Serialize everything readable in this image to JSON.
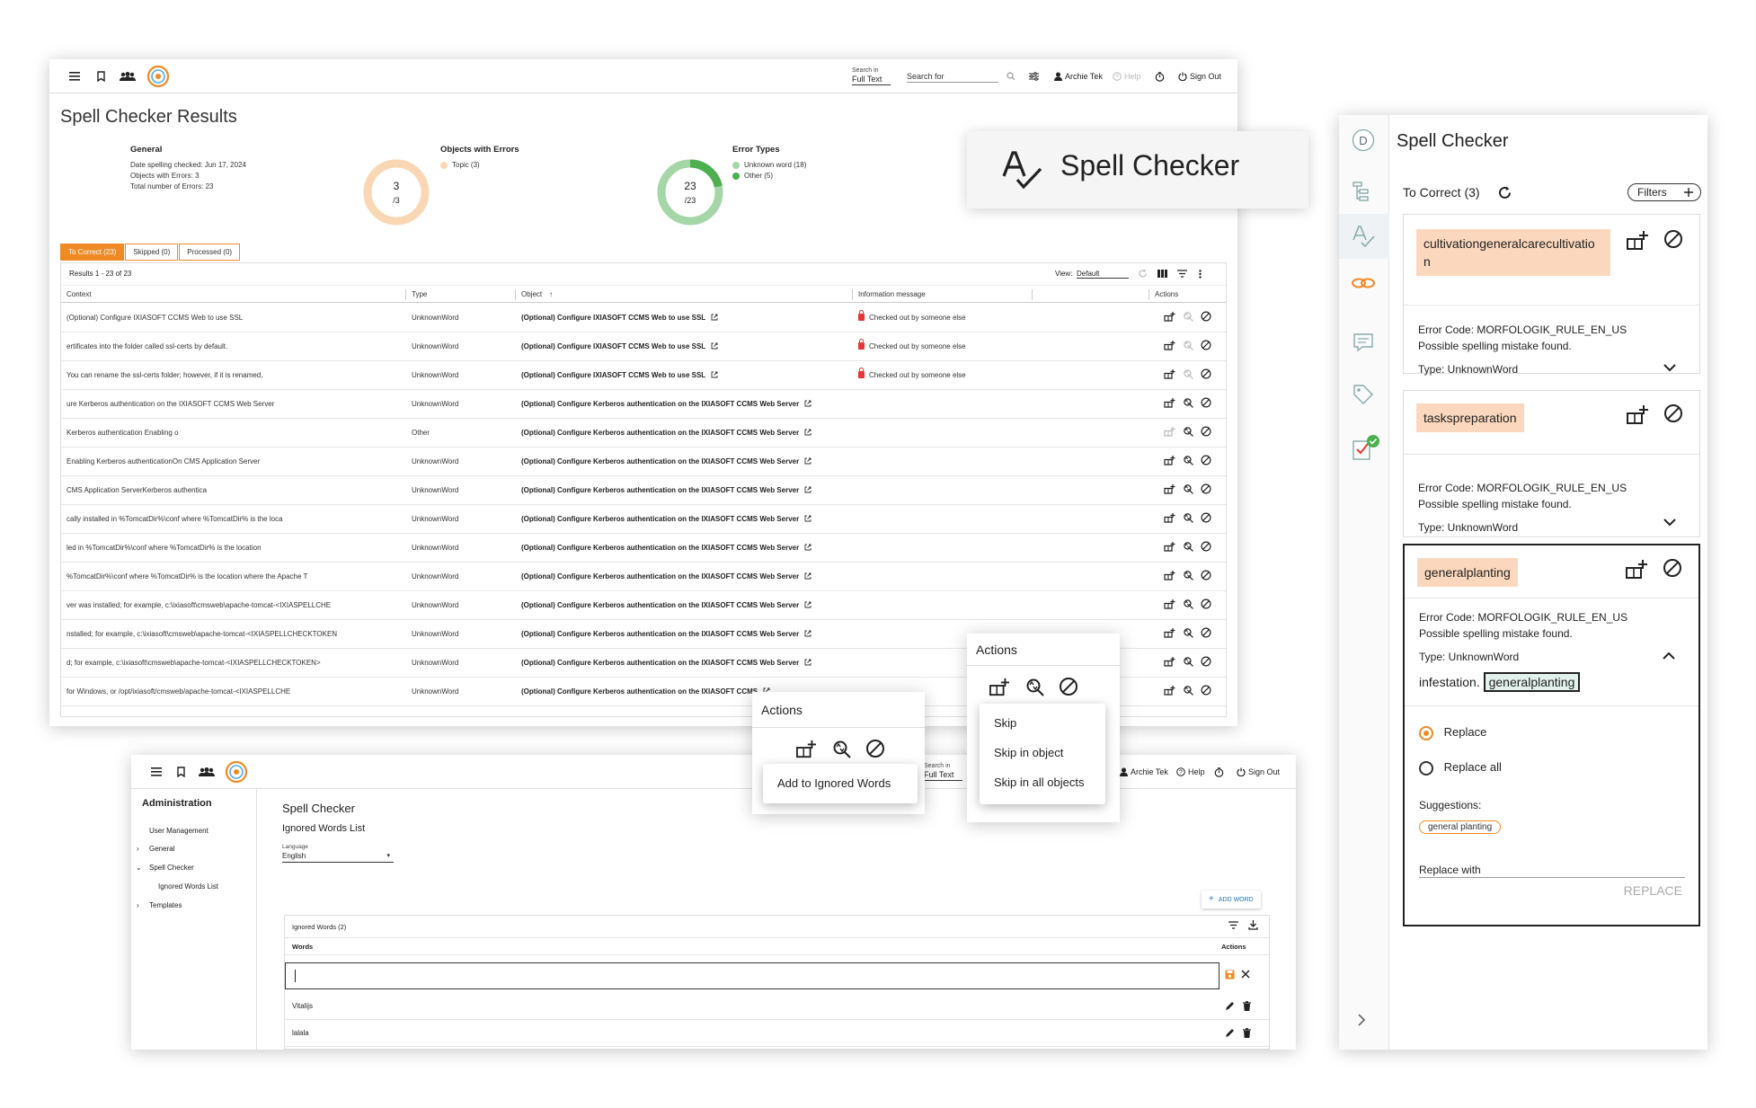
{
  "main": {
    "header": {
      "search_in_label": "Search in",
      "search_in_value": "Full Text",
      "search_placeholder": "Search for",
      "user": "Archie Tek",
      "help": "Help",
      "sign_out": "Sign Out"
    },
    "title": "Spell Checker Results",
    "general": {
      "heading": "General",
      "date": "Date spelling checked: Jun 17, 2024",
      "objects": "Objects with Errors: 3",
      "total": "Total number of Errors: 23"
    },
    "objects_with_errors": {
      "heading": "Objects with Errors",
      "legend": "Topic (3)",
      "value": "3",
      "total": "/3",
      "fraction": 1.0,
      "color": "#f9d7b4"
    },
    "error_types": {
      "heading": "Error Types",
      "legend": [
        "Unknown word (18)",
        "Other (5)"
      ],
      "colors": [
        "#a5d6a7",
        "#4caf50"
      ],
      "value": "23",
      "total": "/23",
      "unknown": 18,
      "other": 5
    },
    "tabs": [
      "To Correct (23)",
      "Skipped (0)",
      "Processed (0)"
    ],
    "results_count": "Results 1 - 23 of 23",
    "view_label": "View:",
    "view_value": "Default",
    "columns": [
      "Context",
      "Type",
      "Object",
      "Information message",
      "Actions"
    ],
    "rows": [
      {
        "context": "(Optional) Configure IXIASOFT CCMS Web to use SSL",
        "type": "UnknownWord",
        "object": "(Optional) Configure IXIASOFT CCMS Web to use SSL",
        "info": "Checked out by someone else"
      },
      {
        "context": "ertificates into the folder called ssl-certs by default.",
        "type": "UnknownWord",
        "object": "(Optional) Configure IXIASOFT CCMS Web to use SSL",
        "info": "Checked out by someone else"
      },
      {
        "context": "You can rename the ssl-certs folder; however, if it is renamed,",
        "type": "UnknownWord",
        "object": "(Optional) Configure IXIASOFT CCMS Web to use SSL",
        "info": "Checked out by someone else"
      },
      {
        "context": "ure Kerberos authentication on the IXIASOFT CCMS Web Server",
        "type": "UnknownWord",
        "object": "(Optional) Configure Kerberos authentication on the IXIASOFT CCMS Web Server",
        "info": ""
      },
      {
        "context": "Kerberos authentication Enabling o",
        "type": "Other",
        "object": "(Optional) Configure Kerberos authentication on the IXIASOFT CCMS Web Server",
        "info": ""
      },
      {
        "context": "Enabling Kerberos authenticationOn CMS Application Server",
        "type": "UnknownWord",
        "object": "(Optional) Configure Kerberos authentication on the IXIASOFT CCMS Web Server",
        "info": ""
      },
      {
        "context": "CMS Application ServerKerberos authentica",
        "type": "UnknownWord",
        "object": "(Optional) Configure Kerberos authentication on the IXIASOFT CCMS Web Server",
        "info": ""
      },
      {
        "context": "cally installed in %TomcatDir%\\conf where %TomcatDir% is the loca",
        "type": "UnknownWord",
        "object": "(Optional) Configure Kerberos authentication on the IXIASOFT CCMS Web Server",
        "info": ""
      },
      {
        "context": "led in %TomcatDir%\\conf where %TomcatDir% is the location",
        "type": "UnknownWord",
        "object": "(Optional) Configure Kerberos authentication on the IXIASOFT CCMS Web Server",
        "info": ""
      },
      {
        "context": "%TomcatDir%\\conf where %TomcatDir% is the location where the Apache T",
        "type": "UnknownWord",
        "object": "(Optional) Configure Kerberos authentication on the IXIASOFT CCMS Web Server",
        "info": ""
      },
      {
        "context": "ver was installed; for example, c:\\ixiasoft\\cmsweb\\apache-tomcat-<IXIASPELLCHE",
        "type": "UnknownWord",
        "object": "(Optional) Configure Kerberos authentication on the IXIASOFT CCMS Web Server",
        "info": ""
      },
      {
        "context": "nstalled; for example, c:\\ixiasoft\\cmsweb\\apache-tomcat-<IXIASPELLCHECKTOKEN",
        "type": "UnknownWord",
        "object": "(Optional) Configure Kerberos authentication on the IXIASOFT CCMS Web Server",
        "info": ""
      },
      {
        "context": "d; for example, c:\\ixiasoft\\cmsweb\\apache-tomcat-<IXIASPELLCHECKTOKEN>",
        "type": "UnknownWord",
        "object": "(Optional) Configure Kerberos authentication on the IXIASOFT CCMS Web Server",
        "info": ""
      },
      {
        "context": "for Windows, or /opt/ixiasoft/cmsweb/apache-tomcat-<IXIASPELLCHE",
        "type": "UnknownWord",
        "object": "(Optional) Configure Kerberos authentication on the IXIASOFT CCMS",
        "info": ""
      }
    ]
  },
  "badge": {
    "title": "Spell Checker"
  },
  "panel": {
    "title": "Spell Checker",
    "rail_avatar": "D",
    "to_correct": "To Correct (3)",
    "filters": "Filters",
    "cards": [
      {
        "word_line1": "cultivationgeneralcarecultivatio",
        "word_line2": "n",
        "code": "Error Code: MORFOLOGIK_RULE_EN_US",
        "msg": "Possible spelling mistake found.",
        "type": "Type: UnknownWord"
      },
      {
        "word_line1": "taskspreparation",
        "word_line2": "",
        "code": "Error Code: MORFOLOGIK_RULE_EN_US",
        "msg": "Possible spelling mistake found.",
        "type": "Type: UnknownWord"
      },
      {
        "word_line1": "generalplanting",
        "word_line2": "",
        "code": "Error Code: MORFOLOGIK_RULE_EN_US",
        "msg": "Possible spelling mistake found.",
        "type": "Type: UnknownWord"
      }
    ],
    "context_prefix": "infestation.",
    "context_word": "generalplanting",
    "replace": "Replace",
    "replace_all": "Replace all",
    "suggestions_label": "Suggestions:",
    "suggestion": "general planting",
    "replace_with": "Replace with",
    "replace_button": "REPLACE"
  },
  "admin": {
    "header": {
      "search_in_label": "Search in",
      "search_in_value": "Full Text",
      "user": "Archie Tek",
      "help": "Help",
      "sign_out": "Sign Out"
    },
    "sidebar_title": "Administration",
    "sidebar": [
      "User Management",
      "General",
      "Spell Checker",
      "Ignored Words List",
      "Templates"
    ],
    "title": "Spell Checker",
    "subtitle": "Ignored Words List",
    "language_label": "Language",
    "language": "English",
    "add_word": "ADD WORD",
    "table_title": "Ignored Words (2)",
    "col_words": "Words",
    "col_actions": "Actions",
    "words": [
      "Vitalijs",
      "lalala"
    ]
  },
  "popups": {
    "ignore": {
      "title": "Actions",
      "item": "Add to Ignored Words"
    },
    "skip": {
      "title": "Actions",
      "items": [
        "Skip",
        "Skip in object",
        "Skip in all objects"
      ]
    }
  },
  "colors": {
    "accent": "#f08a24",
    "chip": "#fbd8bd",
    "green": "#4caf50",
    "light_green": "#a5d6a7",
    "peach": "#f9d7b4",
    "error": "#e53935"
  }
}
